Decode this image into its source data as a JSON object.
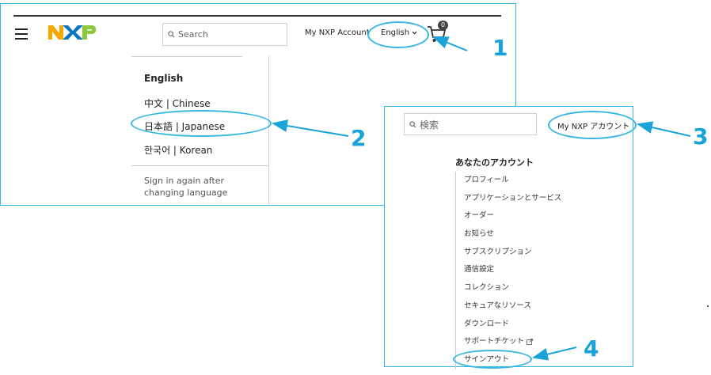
{
  "header": {
    "search_placeholder": "Search",
    "account_label": "My NXP Account",
    "language_label": "English",
    "cart_count": "0"
  },
  "language_menu": {
    "items": [
      "English",
      "中文 | Chinese",
      "日本語 | Japanese",
      "한국어 | Korean"
    ],
    "note": "Sign in again after changing language"
  },
  "jp_header": {
    "search_placeholder": "検索",
    "account_label": "My NXP アカウント"
  },
  "account_menu": {
    "heading": "あなたのアカウント",
    "items": [
      "プロフィール",
      "アプリケーションとサービス",
      "オーダー",
      "お知らせ",
      "サブスクリプション",
      "通信設定",
      "コレクション",
      "セキュアなリソース",
      "ダウンロード",
      "サポートチケット",
      "サインアウト"
    ]
  },
  "callouts": [
    "1",
    "2",
    "3",
    "4"
  ],
  "colors": {
    "callout": "#1aa3d9",
    "panel_border": "#36b7e3"
  },
  "icons": [
    "menu-icon",
    "search-icon",
    "chevron-down-icon",
    "cart-icon",
    "external-link-icon"
  ]
}
